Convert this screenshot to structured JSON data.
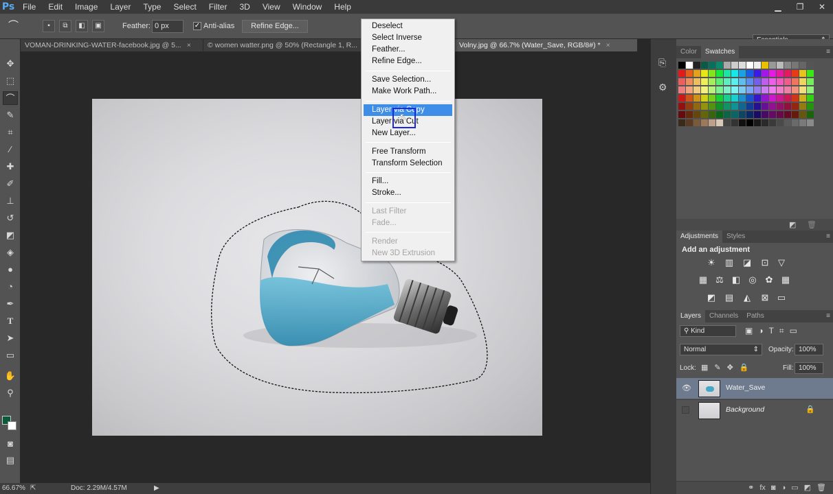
{
  "app": {
    "logo": "Ps"
  },
  "menubar": {
    "items": [
      "File",
      "Edit",
      "Image",
      "Layer",
      "Type",
      "Select",
      "Filter",
      "3D",
      "View",
      "Window",
      "Help"
    ],
    "minimize": "▁",
    "restore": "❐",
    "close": "✕"
  },
  "options": {
    "feather_label": "Feather:",
    "feather_value": "0 px",
    "antialias_label": "Anti-alias",
    "antialias_checked": true,
    "refine_edge": "Refine Edge...",
    "workspace": "Essentials"
  },
  "tabs": [
    {
      "label": "VOMAN-DRINKING-WATER-facebook.jpg @ 5...",
      "active": false
    },
    {
      "label": "© women watter.png @ 50% (Rectangle 1, R...",
      "active": false
    },
    {
      "label": "Volny.jpg @ 66.7% (Water_Save, RGB/8#) *",
      "active": true
    }
  ],
  "context_menu": {
    "groups": [
      [
        {
          "label": "Deselect",
          "enabled": true
        },
        {
          "label": "Select Inverse",
          "enabled": true
        },
        {
          "label": "Feather...",
          "enabled": true
        },
        {
          "label": "Refine Edge...",
          "enabled": true
        }
      ],
      [
        {
          "label": "Save Selection...",
          "enabled": true
        },
        {
          "label": "Make Work Path...",
          "enabled": true
        }
      ],
      [
        {
          "label": "Layer via Copy",
          "enabled": true,
          "highlighted": true
        },
        {
          "label": "Layer via Cut",
          "enabled": true
        },
        {
          "label": "New Layer...",
          "enabled": true
        }
      ],
      [
        {
          "label": "Free Transform",
          "enabled": true
        },
        {
          "label": "Transform Selection",
          "enabled": true
        }
      ],
      [
        {
          "label": "Fill...",
          "enabled": true
        },
        {
          "label": "Stroke...",
          "enabled": true
        }
      ],
      [
        {
          "label": "Last Filter",
          "enabled": false
        },
        {
          "label": "Fade...",
          "enabled": false
        }
      ],
      [
        {
          "label": "Render",
          "enabled": false
        },
        {
          "label": "New 3D Extrusion",
          "enabled": false
        }
      ]
    ]
  },
  "statusbar": {
    "zoom": "66.67%",
    "doc": "Doc: 2.29M/4.57M"
  },
  "color_panel": {
    "tabs": [
      "Color",
      "Swatches"
    ],
    "active": "Swatches"
  },
  "adjustments_panel": {
    "tabs": [
      "Adjustments",
      "Styles"
    ],
    "heading": "Add an adjustment"
  },
  "layers_panel": {
    "tabs": [
      "Layers",
      "Channels",
      "Paths"
    ],
    "kind_filter": "Kind",
    "blend_mode": "Normal",
    "opacity_label": "Opacity:",
    "opacity_value": "100%",
    "lock_label": "Lock:",
    "fill_label": "Fill:",
    "fill_value": "100%",
    "layers": [
      {
        "name": "Water_Save",
        "visible": true,
        "selected": true
      },
      {
        "name": "Background",
        "visible": false,
        "selected": false,
        "locked": true
      }
    ]
  },
  "colors": {
    "accent": "#3e8ee8",
    "foreground": "#0c5a3a",
    "background": "#ffffff",
    "water": "#46a6c8"
  }
}
